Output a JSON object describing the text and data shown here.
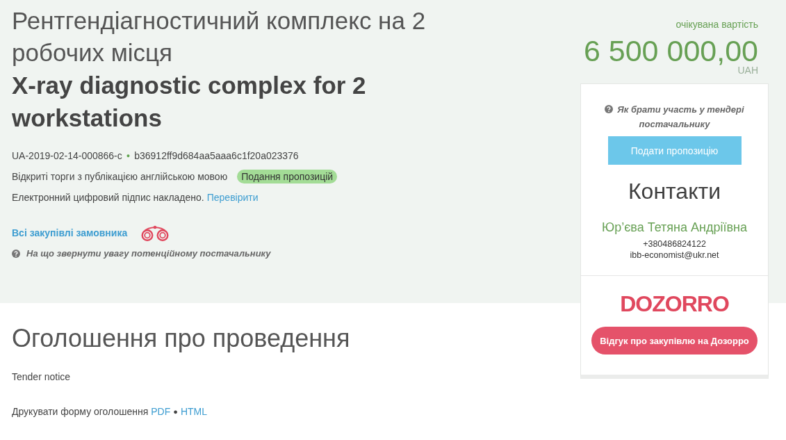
{
  "header": {
    "title_uk": "Рентгендіагностичний комплекс на 2 робочих місця",
    "title_en": "X-ray diagnostic complex for 2 workstations",
    "tender_id": "UA-2019-02-14-000866-c",
    "id_separator": "●",
    "hash": "b36912ff9d684aa5aaa6c1f20a023376",
    "procedure": "Відкриті торги з публікацією англійською мовою",
    "status_badge": "Подання пропозицій",
    "signature_text": "Електронний цифровий підпис накладено.",
    "signature_link": "Перевірити",
    "buyer_link": "Всі закупівлі замовника",
    "hint": "На що звернути увагу потенційному постачальнику"
  },
  "price": {
    "label": "очікувана вартість",
    "amount": "6 500 000,00",
    "currency": "UAH"
  },
  "sidebar": {
    "help": "Як брати участь у тендері постачальнику",
    "submit_button": "Подати пропозицію",
    "contacts_title": "Контакти",
    "contact": {
      "name": "Юр’єва Тетяна Андріївна",
      "phone": "+380486824122",
      "email": "ibb-economist@ukr.net"
    },
    "logo": "DOZORRO",
    "review_button": "Відгук про закупівлю на Дозорро"
  },
  "notice": {
    "title": "Оголошення про проведення",
    "subtitle": "Tender notice",
    "print_label": "Друкувати форму оголошення",
    "print_links": [
      "PDF",
      "HTML"
    ],
    "print_separator": "●"
  }
}
